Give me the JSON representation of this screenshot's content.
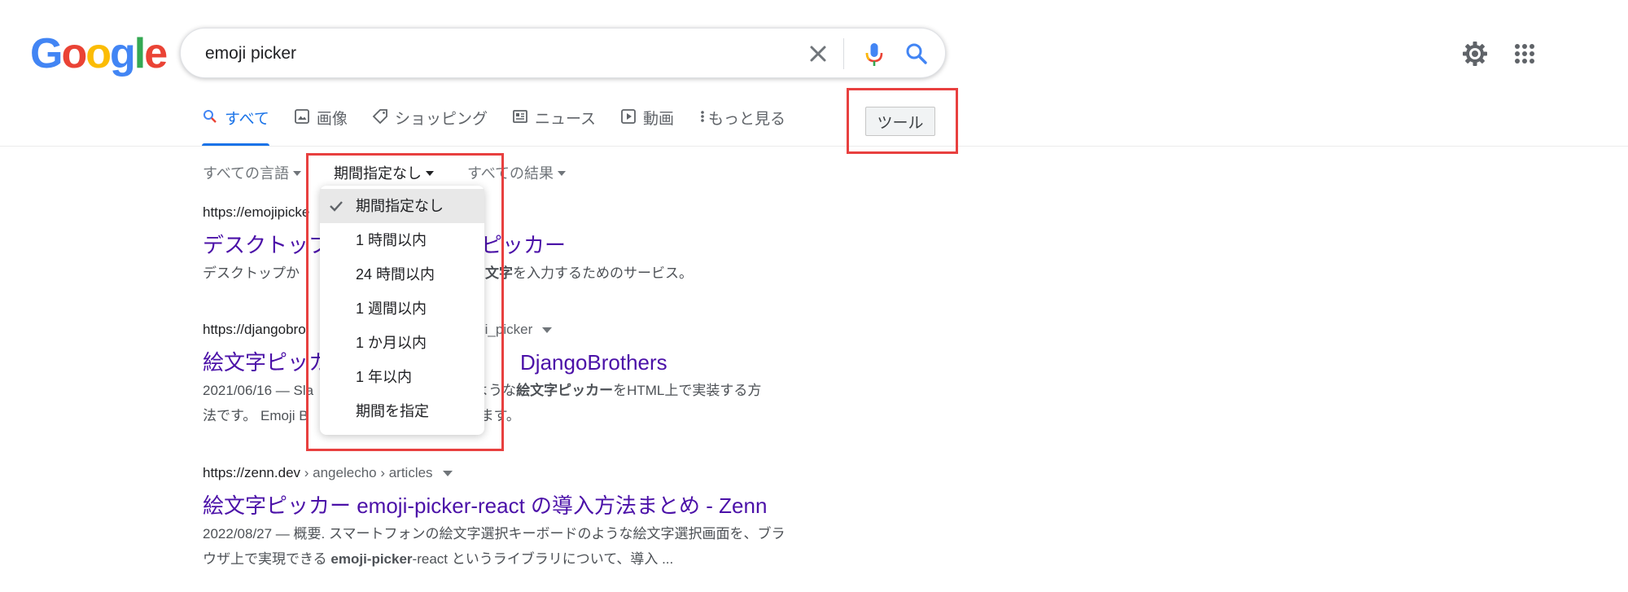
{
  "logo": {
    "letters": [
      "G",
      "o",
      "o",
      "g",
      "l",
      "e"
    ],
    "colors": [
      "#4285F4",
      "#EA4335",
      "#FBBC05",
      "#4285F4",
      "#34A853",
      "#EA4335"
    ]
  },
  "search": {
    "value": "emoji picker"
  },
  "header": {
    "settings_icon": "gear-icon",
    "apps_icon": "apps-grid-icon"
  },
  "tabs": [
    {
      "label": "すべて",
      "icon": "search-icon",
      "active": true
    },
    {
      "label": "画像",
      "icon": "image-icon"
    },
    {
      "label": "ショッピング",
      "icon": "tag-icon"
    },
    {
      "label": "ニュース",
      "icon": "news-icon"
    },
    {
      "label": "動画",
      "icon": "video-icon"
    },
    {
      "label": "もっと見る",
      "icon": "more-vert-icon"
    }
  ],
  "tools": {
    "label": "ツール"
  },
  "filters": [
    {
      "label": "すべての言語"
    },
    {
      "label": "期間指定なし"
    },
    {
      "label": "すべての結果"
    }
  ],
  "time_menu": {
    "items": [
      "期間指定なし",
      "1 時間以内",
      "24 時間以内",
      "1 週間以内",
      "1 か月以内",
      "1 年以内",
      "期間を指定"
    ],
    "selected_index": 0
  },
  "results": [
    {
      "url": "https://emojipicke",
      "title_left": "デスクトップ",
      "title_right": "ピッカー",
      "snippet_left": "デスクトップか",
      "snippet_bold": "文字",
      "snippet_right": "を入力するためのサービス。"
    },
    {
      "url": "https://djangobro",
      "url_tail": "i_picker",
      "title_left": "絵文字ピッカ",
      "title_right": "DjangoBrothers",
      "line1_date": "2021/06/16 — Sla",
      "line1_mid": "で見るような",
      "line1_bold": "絵文字ピッカー",
      "line1_tail": "をHTML上で実装する方",
      "line2_left": "法です。 Emoji B",
      "line2_right": "を使います。"
    },
    {
      "url_host": "https://zenn.dev",
      "url_path": " › angelecho › articles",
      "title": "絵文字ピッカー emoji-picker-react の導入方法まとめ - Zenn",
      "line1": "2022/08/27 — 概要. スマートフォンの絵文字選択キーボードのような絵文字選択画面を、ブラ",
      "line2_left": "ウザ上で実現できる ",
      "line2_bold": "emoji-picker",
      "line2_right": "-react というライブラリについて、導入 ..."
    }
  ],
  "colors": {
    "accent": "#1a73e8",
    "link": "#4b11a8",
    "highlight": "#e8403f"
  }
}
